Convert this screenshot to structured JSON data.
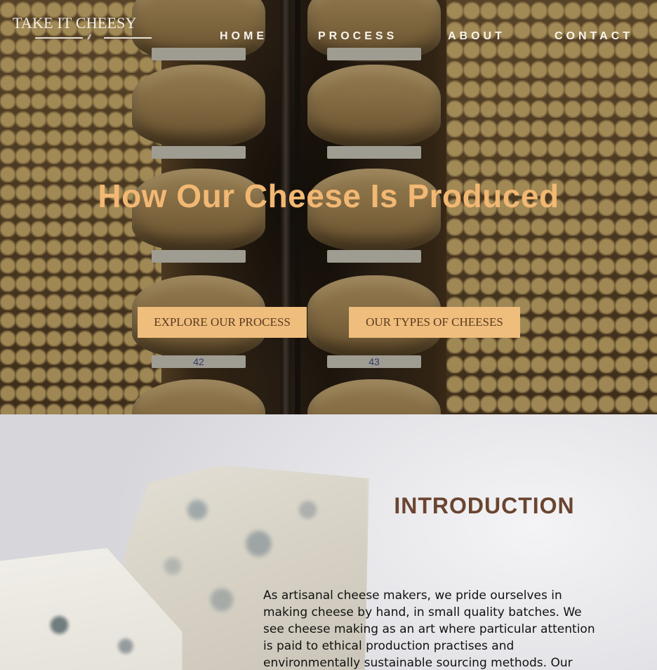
{
  "header": {
    "logo_text": "TAKE IT CHEESY",
    "nav": [
      {
        "label": "HOME"
      },
      {
        "label": "PROCESS"
      },
      {
        "label": "ABOUT"
      },
      {
        "label": "CONTACT"
      }
    ]
  },
  "hero": {
    "title": "How Our Cheese Is Produced",
    "buttons": [
      {
        "label": "EXPLORE OUR PROCESS"
      },
      {
        "label": "OUR TYPES OF CHEESES"
      }
    ],
    "shelf_numbers": [
      "42",
      "43"
    ]
  },
  "intro": {
    "title": "INTRODUCTION",
    "text": "As artisanal cheese makers, we pride ourselves in making cheese by hand, in small quality batches. We see cheese making as an art where particular attention is paid to ethical production practises and environmentally sustainable sourcing methods. Our cheese are produced"
  },
  "colors": {
    "accent": "#efbd7c",
    "hero_title": "#f2b873",
    "intro_title": "#6b4530"
  }
}
